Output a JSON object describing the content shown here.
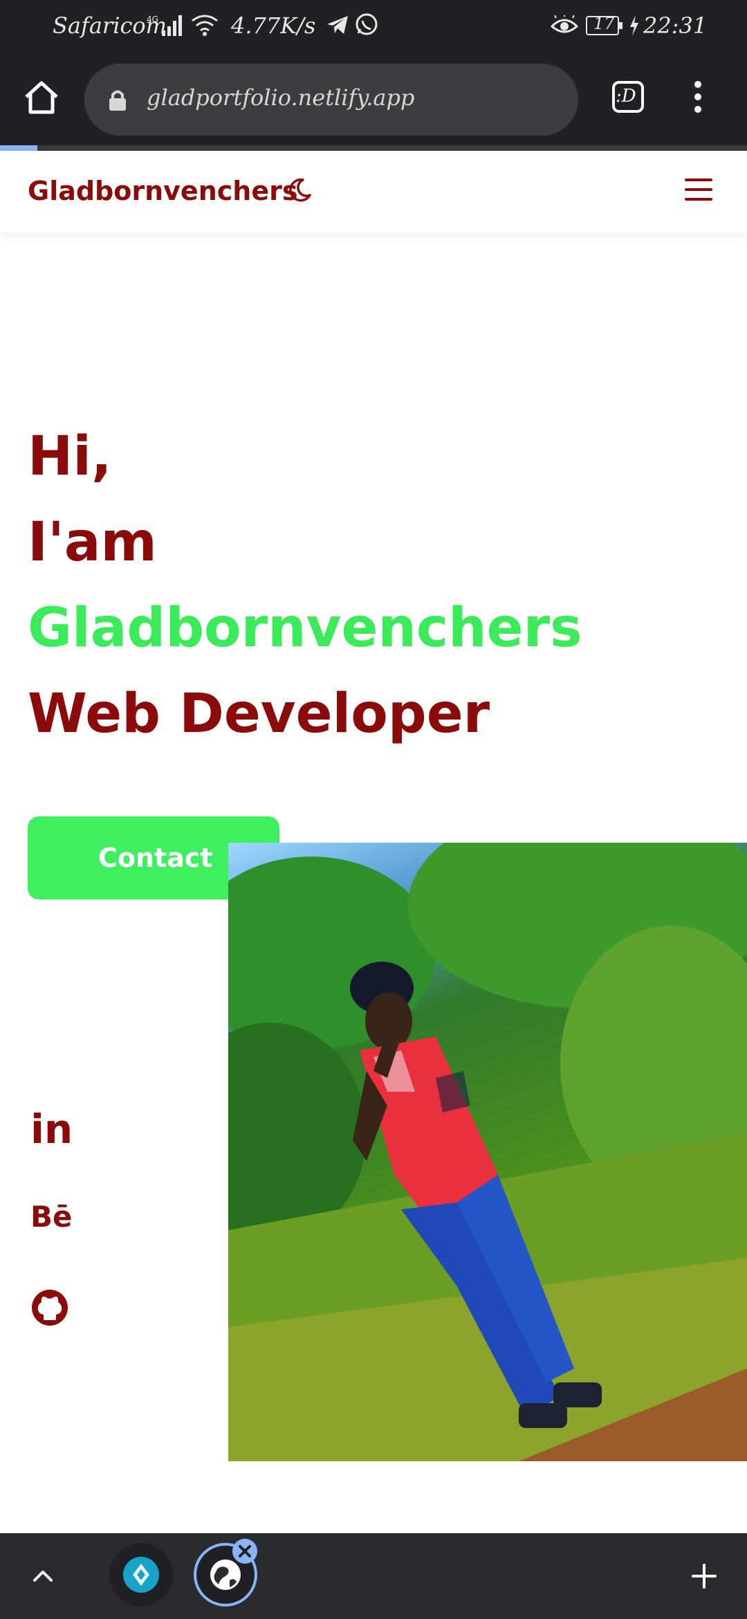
{
  "status_bar": {
    "carrier": "Safaricom",
    "network": "4G",
    "speed": "4.77K/s",
    "battery": "17",
    "time": "22:31"
  },
  "browser": {
    "url": "gladportfolio.netlify.app",
    "tab_button_label": ":D",
    "progress_fraction": 0.05
  },
  "site": {
    "logo": "Gladbornvenchers",
    "hero": {
      "line1": "Hi,",
      "line2": "I'am",
      "name": "Gladbornvenchers",
      "role": "Web Developer"
    },
    "contact_label": "Contact",
    "social": {
      "linkedin": "in",
      "behance": "Bē"
    }
  },
  "colors": {
    "brand": "#8b0a0a",
    "accent": "#3ceb5a",
    "browser_chrome": "#202124"
  },
  "icons": {
    "home": "home-icon",
    "lock": "lock-icon",
    "moon": "moon-icon",
    "menu": "hamburger-icon",
    "github": "github-icon"
  }
}
